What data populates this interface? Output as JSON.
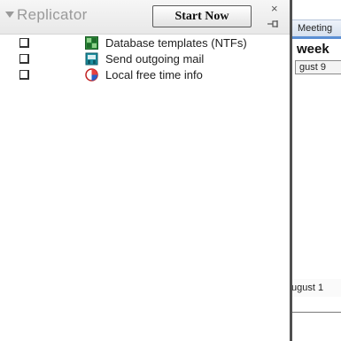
{
  "panel": {
    "title": "Replicator",
    "start_button": "Start Now",
    "close_glyph": "×"
  },
  "tasks": [
    {
      "label": "Database templates (NTFs)",
      "checked": false,
      "icon": "database-templates-icon"
    },
    {
      "label": "Send outgoing mail",
      "checked": false,
      "icon": "outgoing-mail-icon"
    },
    {
      "label": "Local free time info",
      "checked": false,
      "icon": "free-time-icon"
    }
  ],
  "calendar": {
    "tab": "Meeting",
    "week_heading": "week",
    "date_top": "gust 9",
    "date_lower": "ugust 1"
  },
  "colors": {
    "accent_blue": "#5b8fd4",
    "splitter": "#505050",
    "title_gray": "#9a9a9a"
  }
}
